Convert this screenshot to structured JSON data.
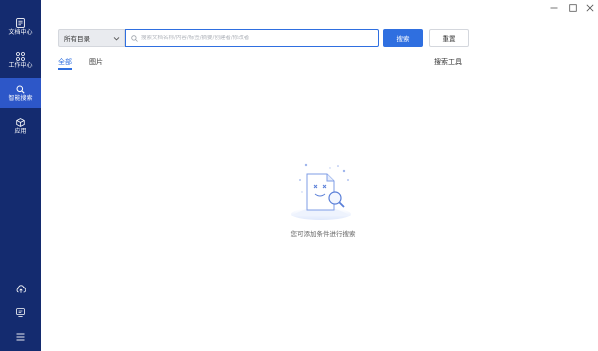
{
  "sidebar": {
    "items": [
      {
        "label": "文档中心",
        "icon": "document-icon"
      },
      {
        "label": "工作中心",
        "icon": "grid-icon"
      },
      {
        "label": "智能搜索",
        "icon": "search-icon",
        "active": true
      },
      {
        "label": "应用",
        "icon": "cube-icon"
      }
    ],
    "bottom_icons": [
      "cloud-upload-icon",
      "monitor-icon",
      "menu-icon"
    ]
  },
  "window_controls": [
    "minimize-icon",
    "maximize-icon",
    "close-icon"
  ],
  "search": {
    "directory_value": "所有目录",
    "placeholder": "搜索文档名称/内容/标签/摘要/创建者/修改者",
    "search_label": "搜索",
    "reset_label": "重置"
  },
  "tabs": [
    {
      "label": "全部",
      "active": true
    },
    {
      "label": "图片",
      "active": false
    }
  ],
  "tools_label": "搜索工具",
  "empty_state": {
    "message": "您可添加条件进行搜索"
  },
  "colors": {
    "sidebar_bg": "#142b6f",
    "sidebar_active": "#2d57c8",
    "accent": "#2f6fe0"
  }
}
